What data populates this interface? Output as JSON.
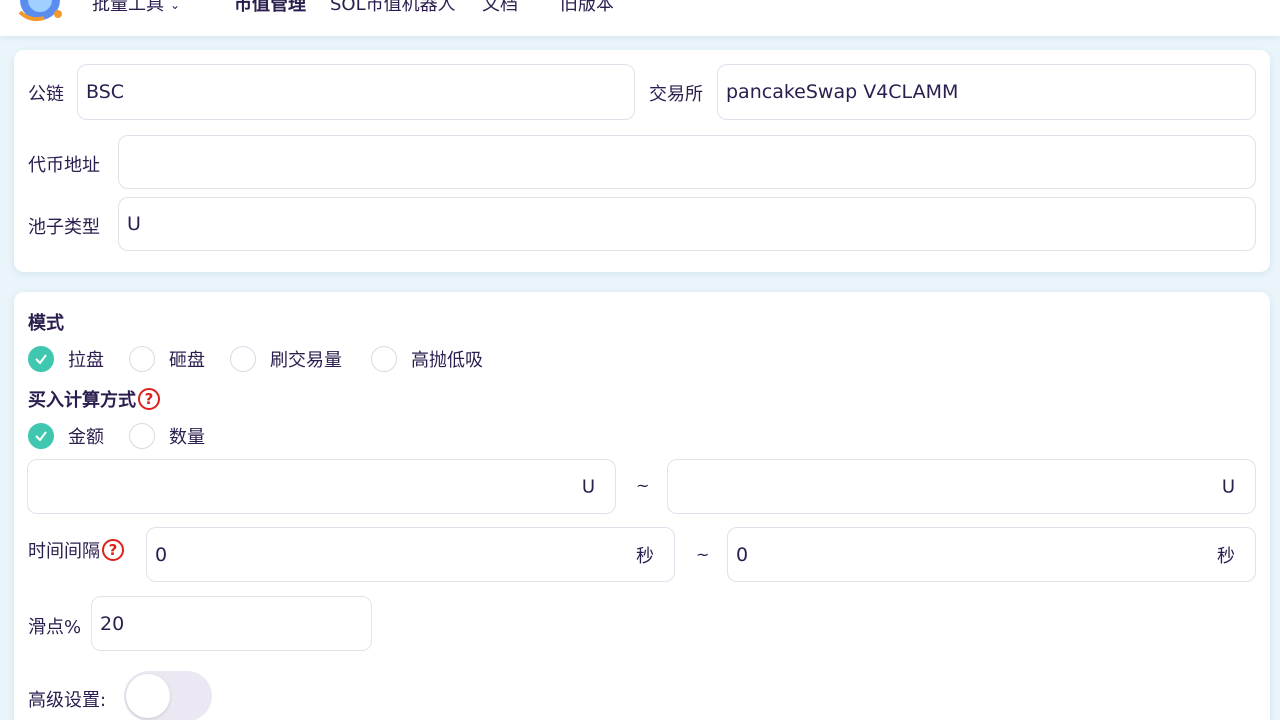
{
  "nav": {
    "batch_tools": "批量工具",
    "market_cap": "市值管理",
    "sol_bot": "SOL市值机器人",
    "docs": "文档",
    "old_version": "旧版本"
  },
  "pool": {
    "chain_label": "公链",
    "chain_value": "BSC",
    "exchange_label": "交易所",
    "exchange_value": "pancakeSwap V4CLAMM",
    "token_label": "代币地址",
    "token_value": "",
    "pool_type_label": "池子类型",
    "pool_type_value": "U"
  },
  "settings": {
    "mode_title": "模式",
    "modes": [
      {
        "label": "拉盘",
        "checked": true
      },
      {
        "label": "砸盘",
        "checked": false
      },
      {
        "label": "刷交易量",
        "checked": false
      },
      {
        "label": "高抛低吸",
        "checked": false
      }
    ],
    "buy_calc_title": "买入计算方式",
    "buy_calc_options": [
      {
        "label": "金额",
        "checked": true
      },
      {
        "label": "数量",
        "checked": false
      }
    ],
    "amount_min": "",
    "amount_max": "",
    "amount_unit": "U",
    "range_sep": "~",
    "interval_label": "时间间隔",
    "interval_min": "0",
    "interval_max": "0",
    "interval_unit": "秒",
    "slippage_label": "滑点%",
    "slippage_value": "20",
    "advanced_label": "高级设置:",
    "advanced_enabled": false
  },
  "colors": {
    "accent_check": "#3fc7b0",
    "help_red": "#e0201c",
    "text": "#2b1d4e",
    "background": "#eaf5fb"
  }
}
